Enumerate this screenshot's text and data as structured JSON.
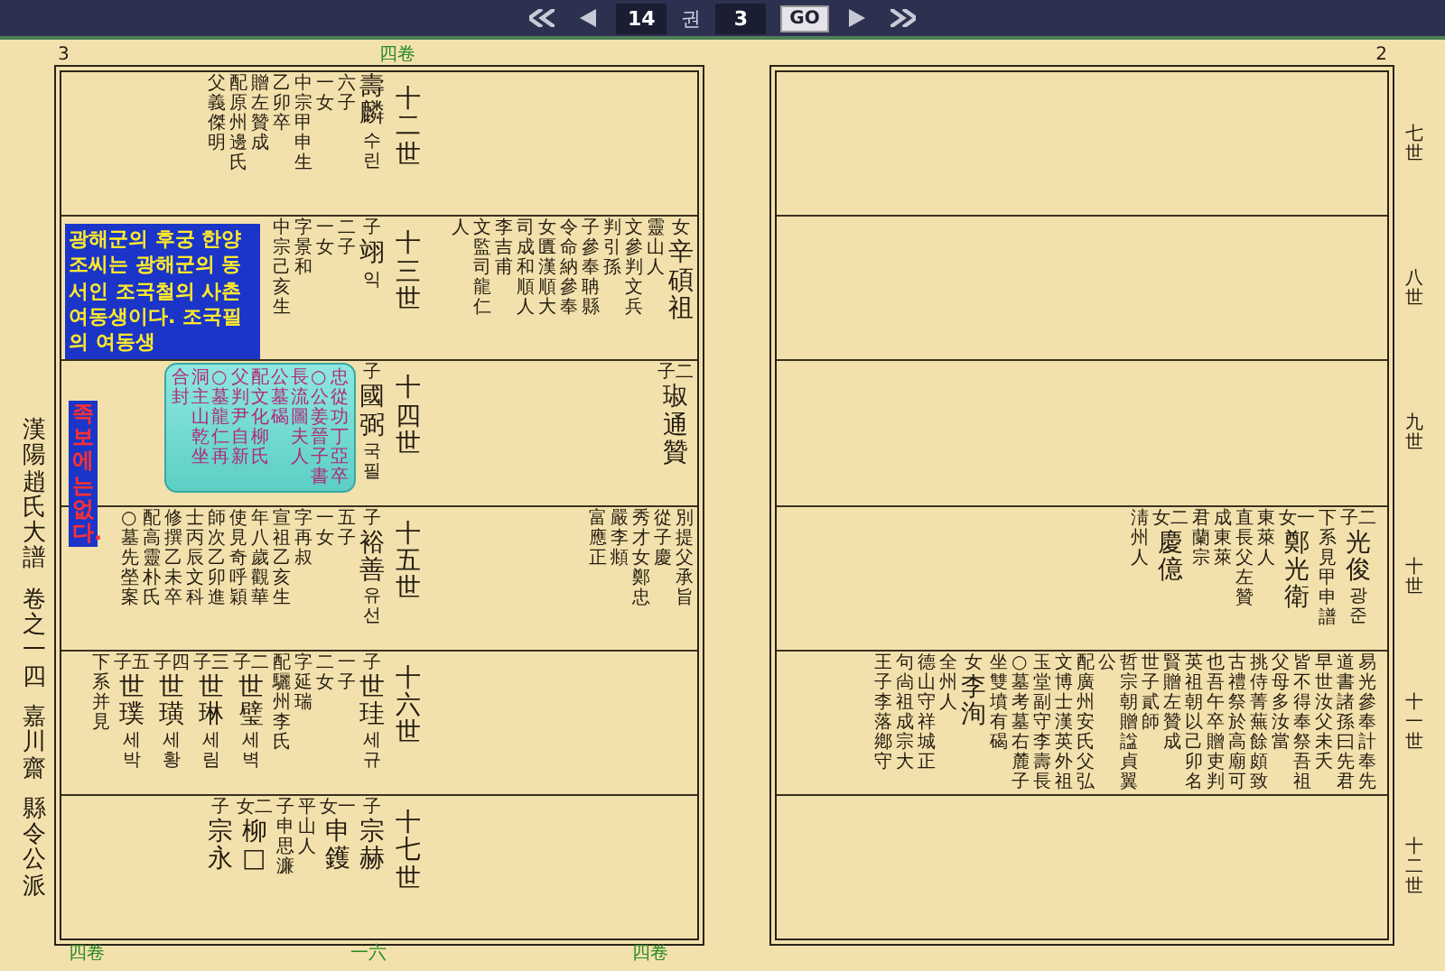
{
  "toolbar": {
    "volume": "14",
    "volume_unit": "권",
    "page": "3",
    "go_label": "GO"
  },
  "left_page": {
    "number": "3",
    "side_title": [
      "漢陽趙氏大譜",
      "卷之一四",
      "嘉川齋",
      "縣令公派"
    ],
    "top_mark": "四卷",
    "bottom_marks": [
      "四卷",
      "一六",
      "四卷"
    ],
    "annotation": {
      "text": "광해군의 후궁 한양조씨는 광해군의 동서인 조국철의 사촌 여동생이다. 조국필의 여동생",
      "remark": "족보에는 없다."
    },
    "rows": [
      {
        "left_side": [
          {
            "notes": [
              "父義傑明",
              "配原州邊氏",
              "贈左贊成",
              "乙卯卒",
              "中宗甲申生"
            ],
            "children": [
              "一女",
              "六子"
            ],
            "name": "壽麟",
            "reading": "수린"
          }
        ],
        "generation": "十二世",
        "right_side": []
      },
      {
        "left_side": [
          {
            "notes": [
              "中宗己亥生",
              "字景和"
            ],
            "children": [
              "一女",
              "二子"
            ],
            "relation": "子",
            "name": "翊",
            "reading": "익"
          }
        ],
        "generation": "十三世",
        "right_side": [
          {
            "notes": [
              "人",
              "文監司龍仁",
              "李吉甫",
              "司成和順人",
              "女匱漢順大",
              "令命納參奉",
              "子參奉聃縣",
              "判引孫",
              "文參判文兵",
              "靈山人"
            ],
            "relation": "女",
            "name": "辛碩祖"
          }
        ]
      },
      {
        "box_notes": [
          "合封",
          "洞主山乾坐",
          "○墓龍仁再",
          "父判尹自新",
          "配文化柳氏",
          "公墓碣",
          "長流圖夫人",
          "○公姜晉子書",
          "忠從功丁亞卒"
        ],
        "left_side": [
          {
            "relation": "子",
            "name": "國弼",
            "reading": "국필"
          }
        ],
        "generation": "十四世",
        "right_side": [
          {
            "relation": "子二",
            "name": "琡通贊"
          }
        ]
      },
      {
        "left_side": [
          {
            "notes": [
              "○墓先塋案",
              "配高靈朴氏",
              "修撰乙未卒",
              "士丙辰文科",
              "師次乙卯進",
              "使見奇呼穎",
              "年八歲觀華",
              "宣祖乙亥生",
              "字再叔"
            ],
            "children": [
              "一女",
              "五子"
            ],
            "relation": "子",
            "name": "裕善",
            "reading": "유선"
          }
        ],
        "generation": "十五世",
        "right_side": [
          {
            "notes": [
              "富應正",
              "嚴李頫",
              "秀才女鄭忠",
              "從子慶",
              "別提父承旨"
            ]
          }
        ]
      },
      {
        "left_side": [
          {
            "notes": [
              "下系并見"
            ],
            "relation": "子五",
            "name": "世璞",
            "reading": "세박"
          },
          {
            "relation": "子四",
            "name": "世璜",
            "reading": "세황"
          },
          {
            "relation": "子三",
            "name": "世琳",
            "reading": "세림"
          },
          {
            "relation": "子二",
            "name": "世璧",
            "reading": "세벽"
          },
          {
            "notes": [
              "配驪州李氏",
              "字延瑞"
            ],
            "children": [
              "二女",
              "一子"
            ],
            "relation": "子",
            "name": "世珪",
            "reading": "세규"
          }
        ],
        "generation": "十六世",
        "right_side": []
      },
      {
        "left_side": [
          {
            "relation": "子",
            "name": "宗永"
          },
          {
            "relation": "女二",
            "name": "柳□"
          },
          {
            "notes": [
              "子申思濂",
              "平山人"
            ],
            "relation": "女一",
            "name": "申鑊"
          },
          {
            "relation": "子",
            "name": "宗赫"
          }
        ],
        "generation": "十七世",
        "right_side": []
      }
    ]
  },
  "right_page": {
    "number": "2",
    "rows": [
      {
        "entries": [],
        "generation": "七世"
      },
      {
        "entries": [],
        "generation": "八世"
      },
      {
        "entries": [],
        "generation": "九世"
      },
      {
        "entries": [
          {
            "notes": [
              "淸州人"
            ],
            "relation": "女二",
            "name": "慶億"
          },
          {
            "notes": [
              "君蘭宗",
              "成東萊",
              "直長父左贊",
              "東萊人"
            ],
            "relation": "女一",
            "name": "鄭光衛"
          },
          {
            "notes": [
              "下系見甲申譜"
            ],
            "relation": "子二",
            "name": "光俊",
            "reading": "광준"
          }
        ],
        "generation": "十世"
      },
      {
        "entries": [
          {
            "notes": [
              "王子李落鄕守",
              "句尙祖成宗大",
              "德山守祥城正",
              "全州人"
            ],
            "relation": "女",
            "name": "李洵"
          },
          {
            "notes": [
              "坐雙墳有碣",
              "○墓考墓右麓子",
              "玉堂副守李壽長",
              "文博士漢英外祖",
              "配廣州安氏父弘",
              "公",
              "哲宗朝贈諡貞翼",
              "世子貳師",
              "賢贈左贊成",
              "英祖朝以己卯名",
              "也吾午卒贈吏判",
              "古禮祭於高廟可",
              "挑侍菁蕪餘頗致",
              "父母多汝當",
              "皆不得奉祭吾祖",
              "早世汝父未夭",
              "道書諸孫曰先君",
              "易光參奉計奉先"
            ]
          }
        ],
        "generation": "十一世"
      },
      {
        "entries": [],
        "generation": "十二世"
      }
    ]
  }
}
